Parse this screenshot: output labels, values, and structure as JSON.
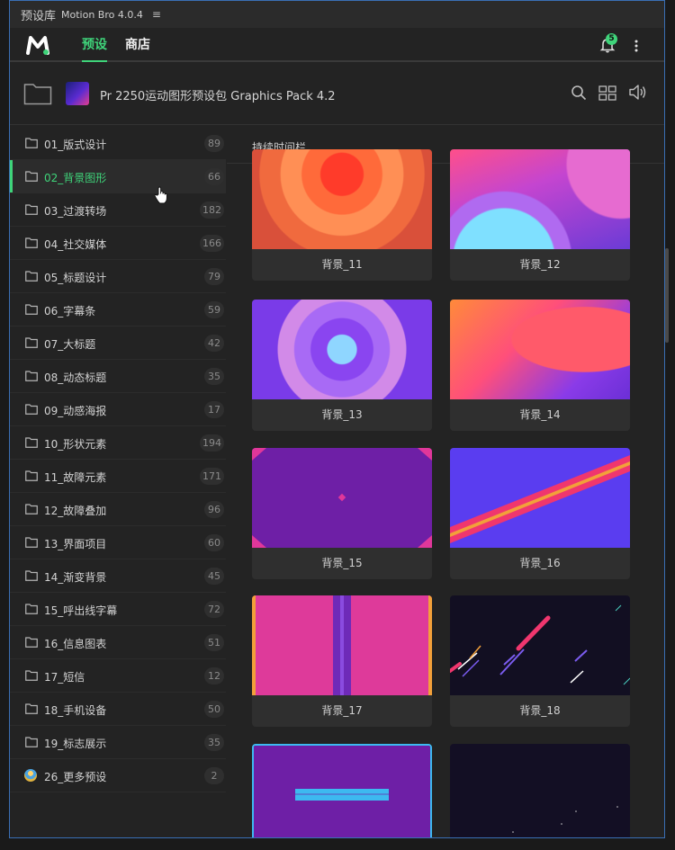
{
  "window": {
    "title": "预设库",
    "app_name": "Motion Bro 4.0.4",
    "menu_icon": "hamburger-icon"
  },
  "nav": {
    "tabs": [
      {
        "label": "预设",
        "active": true
      },
      {
        "label": "商店",
        "active": false
      }
    ],
    "notification_count": "5",
    "accent": "#3fd47a"
  },
  "pack": {
    "title": "Pr 2250运动图形预设包 Graphics Pack 4.2"
  },
  "categories": [
    {
      "label": "01_版式设计",
      "count": "89"
    },
    {
      "label": "02_背景图形",
      "count": "66",
      "active": true
    },
    {
      "label": "03_过渡转场",
      "count": "182"
    },
    {
      "label": "04_社交媒体",
      "count": "166"
    },
    {
      "label": "05_标题设计",
      "count": "79"
    },
    {
      "label": "06_字幕条",
      "count": "59"
    },
    {
      "label": "07_大标题",
      "count": "42"
    },
    {
      "label": "08_动态标题",
      "count": "35"
    },
    {
      "label": "09_动感海报",
      "count": "17"
    },
    {
      "label": "10_形状元素",
      "count": "194"
    },
    {
      "label": "11_故障元素",
      "count": "171"
    },
    {
      "label": "12_故障叠加",
      "count": "96"
    },
    {
      "label": "13_界面项目",
      "count": "60"
    },
    {
      "label": "14_渐变背景",
      "count": "45"
    },
    {
      "label": "15_呼出线字幕",
      "count": "72"
    },
    {
      "label": "16_信息图表",
      "count": "51"
    },
    {
      "label": "17_短信",
      "count": "12"
    },
    {
      "label": "18_手机设备",
      "count": "50"
    },
    {
      "label": "19_标志展示",
      "count": "35"
    },
    {
      "label": "26_更多预设",
      "count": "2"
    }
  ],
  "content": {
    "section_title": "持续时间栏",
    "presets": [
      {
        "name": "背景_11"
      },
      {
        "name": "背景_12"
      },
      {
        "name": "背景_13"
      },
      {
        "name": "背景_14"
      },
      {
        "name": "背景_15"
      },
      {
        "name": "背景_16"
      },
      {
        "name": "背景_17"
      },
      {
        "name": "背景_18"
      },
      {
        "name": ""
      },
      {
        "name": ""
      }
    ]
  }
}
